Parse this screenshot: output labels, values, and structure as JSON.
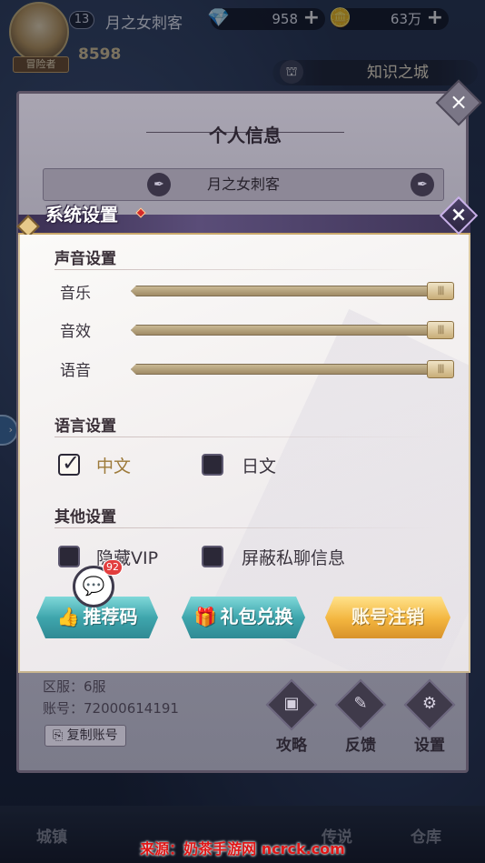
{
  "hud": {
    "player_tag": "冒险者",
    "level": "13",
    "player_name": "月之女刺客",
    "diamonds": "958",
    "gold": "63万",
    "power": "8598",
    "city": "知识之城",
    "icons": {
      "diamond": "diamond-icon",
      "gold": "gold-coin-icon",
      "plus": "plus-icon"
    }
  },
  "info_panel": {
    "title": "个人信息",
    "name": "月之女刺客",
    "server_label": "区服：6服",
    "account_label": "账号：72000614191",
    "copy_button": "复制账号",
    "side_buttons": [
      "攻略",
      "反馈",
      "设置"
    ]
  },
  "settings": {
    "title": "系统设置",
    "sound_section": "声音设置",
    "sliders": [
      {
        "label": "音乐",
        "level": 1.0
      },
      {
        "label": "音效",
        "level": 1.0
      },
      {
        "label": "语音",
        "level": 1.0
      }
    ],
    "language_section": "语言设置",
    "languages": [
      {
        "label": "中文",
        "checked": true
      },
      {
        "label": "日文",
        "checked": false
      }
    ],
    "other_section": "其他设置",
    "others": [
      {
        "label": "隐藏VIP",
        "checked": false
      },
      {
        "label": "屏蔽私聊信息",
        "checked": false
      }
    ],
    "buttons": {
      "referral": "推荐码",
      "gift": "礼包兑换",
      "cancel_account": "账号注销"
    }
  },
  "chat": {
    "badge": "92"
  },
  "bottom_nav": [
    "城镇",
    "传说",
    "仓库"
  ],
  "watermark": "来源：奶茶手游网 ncrck.com",
  "colors": {
    "accent_gold": "#c9a86a",
    "teal_button": "#3fa6ad",
    "gold_button": "#f3b53e",
    "selected_label": "#9d7a3a"
  }
}
